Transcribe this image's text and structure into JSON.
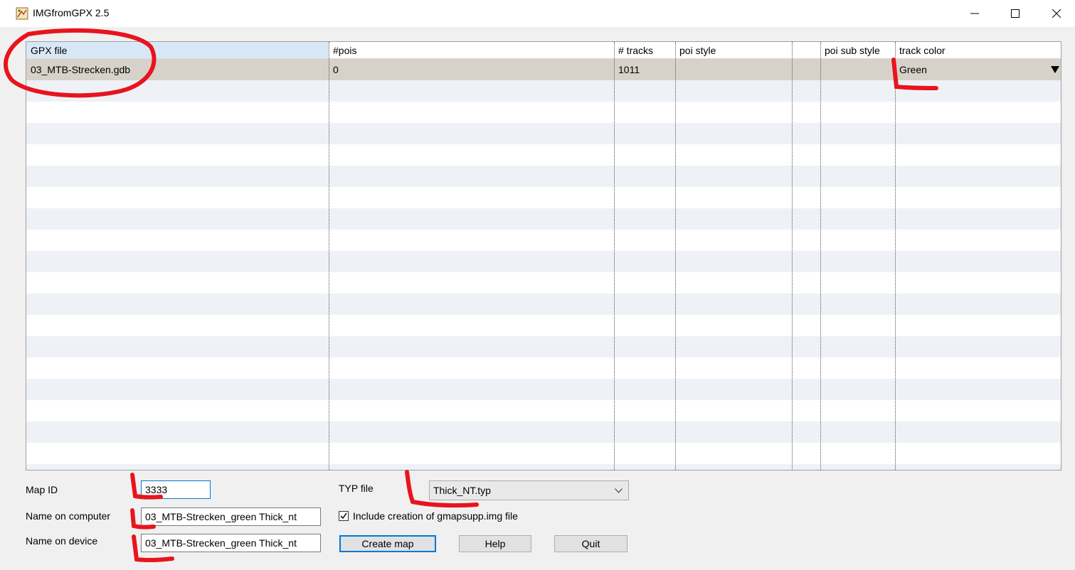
{
  "window": {
    "title": "IMGfromGPX 2.5"
  },
  "grid": {
    "columns": [
      "GPX file",
      "#pois",
      "# tracks",
      "poi style",
      "",
      "poi sub style",
      "track color"
    ],
    "rows": [
      {
        "gpx_file": "03_MTB-Strecken.gdb",
        "pois": "0",
        "tracks": "1011",
        "poi_style": "",
        "extra": "",
        "poi_sub_style": "",
        "track_color": "Green"
      }
    ]
  },
  "form": {
    "map_id_label": "Map ID",
    "map_id_value": "3333",
    "name_computer_label": "Name on computer",
    "name_computer_value": "03_MTB-Strecken_green Thick_nt",
    "name_device_label": "Name on device",
    "name_device_value": "03_MTB-Strecken_green Thick_nt",
    "typ_label": "TYP file",
    "typ_value": "Thick_NT.typ",
    "include_gmapsupp_label": "Include creation of gmapsupp.img file",
    "include_gmapsupp_checked": true
  },
  "buttons": {
    "create_map": "Create map",
    "help": "Help",
    "quit": "Quit"
  },
  "colors": {
    "selected_row": "#d6d2ca",
    "header_selected": "#d9e8f7",
    "stripe": "#eef2f7",
    "annotation": "#e8141d"
  }
}
